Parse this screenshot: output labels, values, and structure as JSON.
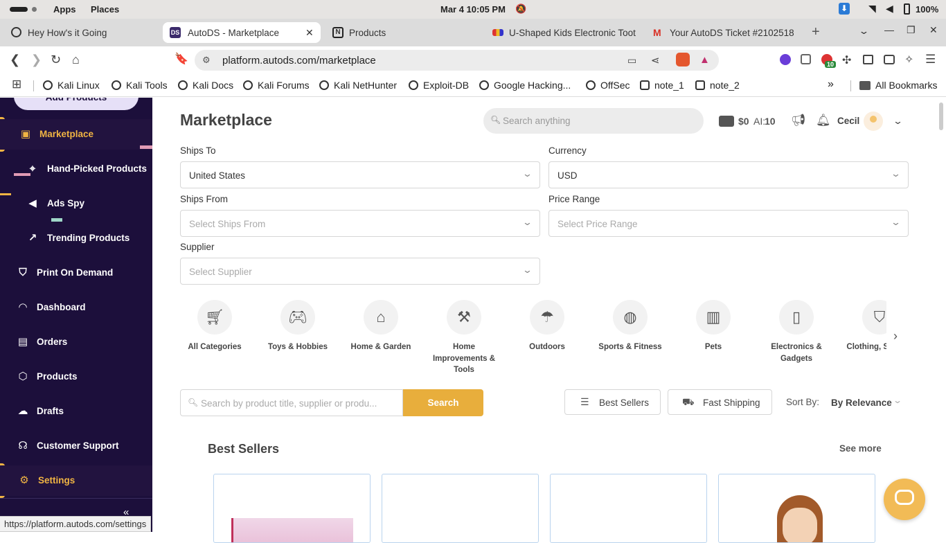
{
  "os_bar": {
    "apps": "Apps",
    "places": "Places",
    "clock": "Mar 4  10:05 PM",
    "battery": "100%"
  },
  "tabs": [
    {
      "title": "Hey How's it Going",
      "active": false
    },
    {
      "title": "AutoDS - Marketplace",
      "active": true,
      "favicon_text": "DS"
    },
    {
      "title": "Products",
      "active": false
    },
    {
      "title": "U-Shaped Kids Electronic Toot",
      "active": false
    },
    {
      "title": "Your AutoDS Ticket #2102518",
      "active": false
    }
  ],
  "address_bar": {
    "url": "platform.autods.com/marketplace"
  },
  "extensions": {
    "badge_count": "10"
  },
  "bookmarks": [
    {
      "label": "Kali Linux"
    },
    {
      "label": "Kali Tools"
    },
    {
      "label": "Kali Docs"
    },
    {
      "label": "Kali Forums"
    },
    {
      "label": "Kali NetHunter"
    },
    {
      "label": "Exploit-DB"
    },
    {
      "label": "Google Hacking..."
    },
    {
      "label": "OffSec"
    },
    {
      "label": "note_1"
    },
    {
      "label": "note_2"
    }
  ],
  "all_bookmarks": "All Bookmarks",
  "sidebar": {
    "add_products": "Add Products",
    "items": [
      {
        "label": "Marketplace",
        "icon": "store-icon",
        "active": true
      },
      {
        "label": "Hand-Picked Products",
        "icon": "hand-picked-icon"
      },
      {
        "label": "Ads Spy",
        "icon": "megaphone-icon"
      },
      {
        "label": "Trending Products",
        "icon": "trend-chart-icon"
      },
      {
        "label": "Print On Demand",
        "icon": "tshirt-icon"
      },
      {
        "label": "Dashboard",
        "icon": "gauge-icon"
      },
      {
        "label": "Orders",
        "icon": "receipt-icon"
      },
      {
        "label": "Products",
        "icon": "box-icon"
      },
      {
        "label": "Drafts",
        "icon": "cloud-upload-icon"
      },
      {
        "label": "Customer Support",
        "icon": "headset-icon"
      },
      {
        "label": "Settings",
        "icon": "gear-icon"
      }
    ]
  },
  "header": {
    "title": "Marketplace",
    "search_placeholder": "Search anything",
    "balance": "$0",
    "ai_label": "AI:",
    "ai_value": "10",
    "user": "Cecil"
  },
  "filters": {
    "ships_to": {
      "label": "Ships To",
      "value": "United States"
    },
    "currency": {
      "label": "Currency",
      "value": "USD"
    },
    "ships_from": {
      "label": "Ships From",
      "placeholder": "Select Ships From"
    },
    "price_range": {
      "label": "Price Range",
      "placeholder": "Select Price Range"
    },
    "supplier": {
      "label": "Supplier",
      "placeholder": "Select Supplier"
    }
  },
  "categories": [
    {
      "label": "All Categories",
      "icon": "cart-icon"
    },
    {
      "label": "Toys & Hobbies",
      "icon": "gamepad-icon"
    },
    {
      "label": "Home & Garden",
      "icon": "house-icon"
    },
    {
      "label": "Home Improvements & Tools",
      "icon": "tools-icon"
    },
    {
      "label": "Outdoors",
      "icon": "umbrella-icon"
    },
    {
      "label": "Sports & Fitness",
      "icon": "basketball-icon"
    },
    {
      "label": "Pets",
      "icon": "pet-food-icon"
    },
    {
      "label": "Electronics & Gadgets",
      "icon": "phone-icon"
    },
    {
      "label": "Clothing, S Jewel",
      "icon": "shirt-icon"
    }
  ],
  "product_search": {
    "placeholder": "Search by product title, supplier or produ...",
    "button": "Search"
  },
  "quick_filters": {
    "best_sellers": "Best Sellers",
    "fast_shipping": "Fast Shipping",
    "sort_by_label": "Sort By:",
    "sort_by_value": "By Relevance"
  },
  "section": {
    "title": "Best Sellers",
    "see_more": "See more"
  },
  "status_url": "https://platform.autods.com/settings",
  "colors": {
    "sidebar_bg": "#1c0f3b",
    "accent": "#f0b443",
    "search_button": "#e8ae3c",
    "card_border": "#b9d3ee"
  }
}
